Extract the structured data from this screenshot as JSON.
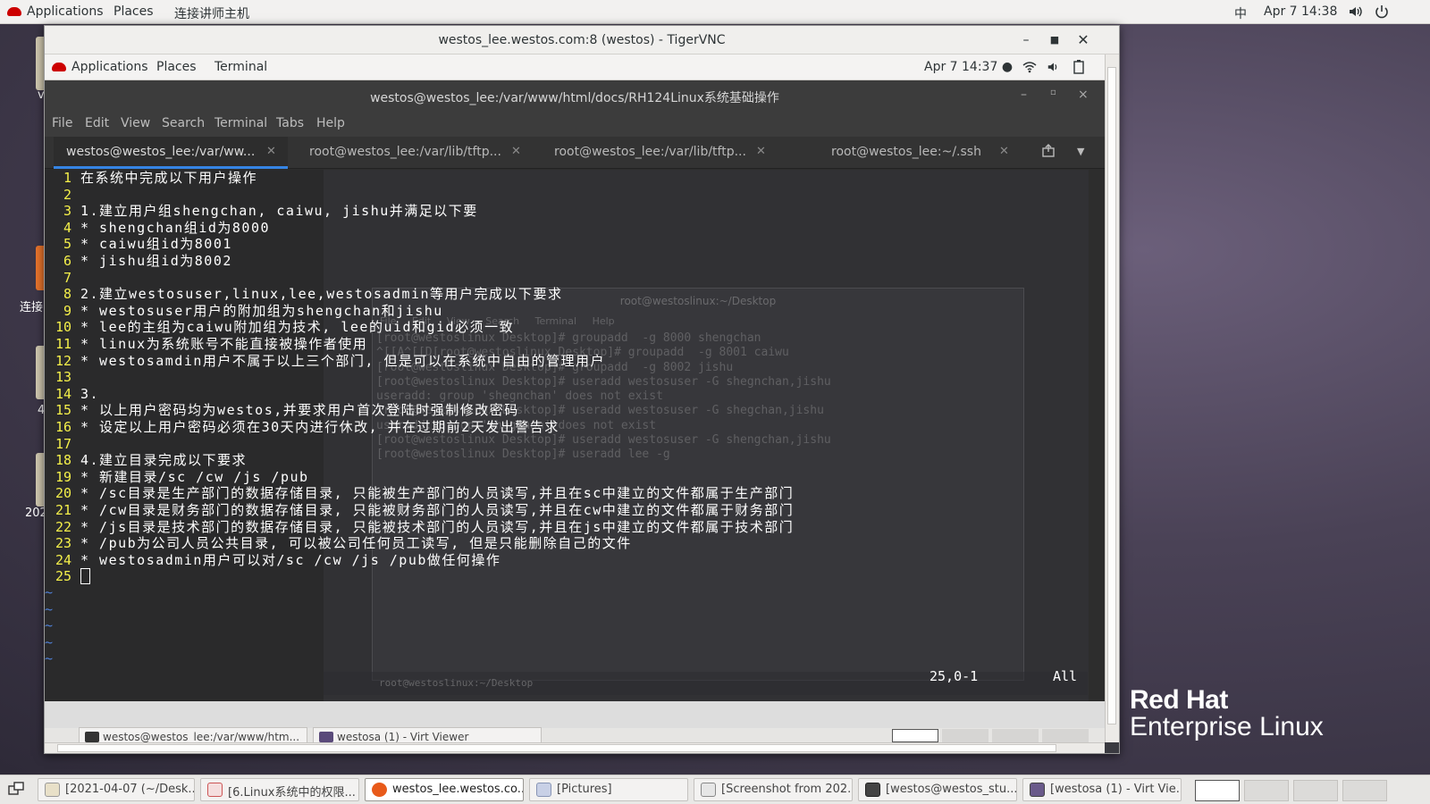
{
  "host": {
    "topbar": {
      "applications": "Applications",
      "places": "Places",
      "connect": "连接讲师主机",
      "input_method": "中",
      "datetime": "Apr 7  14:38"
    },
    "desktop": {
      "partial_label_1": "连接",
      "partial_label_2": "4",
      "partial_label_3": "202",
      "partial_label_4": "v"
    },
    "logo": {
      "line1": "Red Hat",
      "line2": "Enterprise Linux"
    },
    "taskbar": [
      "[2021-04-07 (~/Desk...",
      "[6.Linux系统中的权限...",
      "westos_lee.westos.co...",
      "[Pictures]",
      "[Screenshot from 202...",
      "[westos@westos_stu...",
      "[westosa (1) - Virt Vie..."
    ]
  },
  "vnc": {
    "title": "westos_lee.westos.com:8 (westos) - TigerVNC",
    "vm_topbar": {
      "applications": "Applications",
      "places": "Places",
      "terminal": "Terminal",
      "datetime": "Apr 7  14:37 ●"
    },
    "terminal": {
      "title": "westos@westos_lee:/var/www/html/docs/RH124Linux系统基础操作",
      "menu": [
        "File",
        "Edit",
        "View",
        "Search",
        "Terminal",
        "Tabs",
        "Help"
      ],
      "tabs": [
        "westos@westos_lee:/var/ww...",
        "root@westos_lee:/var/lib/tftp...",
        "root@westos_lee:/var/lib/tftp...",
        "root@westos_lee:~/.ssh"
      ],
      "lines": [
        {
          "n": "1",
          "t": "在系统中完成以下用户操作"
        },
        {
          "n": "2",
          "t": ""
        },
        {
          "n": "3",
          "t": "1.建立用户组shengchan, caiwu, jishu并满足以下要"
        },
        {
          "n": "4",
          "t": "* shengchan组id为8000"
        },
        {
          "n": "5",
          "t": "* caiwu组id为8001"
        },
        {
          "n": "6",
          "t": "* jishu组id为8002"
        },
        {
          "n": "7",
          "t": ""
        },
        {
          "n": "8",
          "t": "2.建立westosuser,linux,lee,westosadmin等用户完成以下要求"
        },
        {
          "n": "9",
          "t": "* westosuser用户的附加组为shengchan和jishu"
        },
        {
          "n": "10",
          "t": "* lee的主组为caiwu附加组为技术, lee的uid和gid必须一致"
        },
        {
          "n": "11",
          "t": "* linux为系统账号不能直接被操作者使用"
        },
        {
          "n": "12",
          "t": "* westosamdin用户不属于以上三个部门, 但是可以在系统中自由的管理用户"
        },
        {
          "n": "13",
          "t": ""
        },
        {
          "n": "14",
          "t": "3."
        },
        {
          "n": "15",
          "t": "* 以上用户密码均为westos,并要求用户首次登陆时强制修改密码"
        },
        {
          "n": "16",
          "t": "* 设定以上用户密码必须在30天内进行休改, 并在过期前2天发出警告求"
        },
        {
          "n": "17",
          "t": ""
        },
        {
          "n": "18",
          "t": "4.建立目录完成以下要求"
        },
        {
          "n": "19",
          "t": "* 新建目录/sc /cw /js /pub"
        },
        {
          "n": "20",
          "t": "* /sc目录是生产部门的数据存储目录, 只能被生产部门的人员读写,并且在sc中建立的文件都属于生产部门"
        },
        {
          "n": "21",
          "t": "* /cw目录是财务部门的数据存储目录, 只能被财务部门的人员读写,并且在cw中建立的文件都属于财务部门"
        },
        {
          "n": "22",
          "t": "* /js目录是技术部门的数据存储目录, 只能被技术部门的人员读写,并且在js中建立的文件都属于技术部门"
        },
        {
          "n": "23",
          "t": "* /pub为公司人员公共目录, 可以被公司任何员工读写, 但是只能删除自己的文件"
        },
        {
          "n": "24",
          "t": "* westosadmin用户可以对/sc /cw /js /pub做任何操作"
        },
        {
          "n": "25",
          "t": ""
        }
      ],
      "tilde": "~",
      "status_pos": "25,0-1",
      "status_all": "All"
    },
    "ghost": {
      "title": "root@westoslinux:~/Desktop",
      "menu": "File Edit View Search Terminal Help",
      "lines": "[root@westoslinux Desktop]# groupadd  -g 8000 shengchan\n^[[A^[[D[root@westoslinux Desktop]# groupadd  -g 8001 caiwu\n[root@westoslinux Desktop]# groupadd  -g 8002 jishu\n[root@westoslinux Desktop]# useradd westosuser -G shegnchan,jishu\nuseradd: group 'shegnchan' does not exist\n[root@westoslinux Desktop]# useradd westosuser -G shegchan,jishu\nuseradd: group 'shegchan' does not exist\n[root@westoslinux Desktop]# useradd westosuser -G shengchan,jishu\n[root@westoslinux Desktop]# useradd lee -g ",
      "taskbar_label": "root@westoslinux:~/Desktop"
    },
    "vm_taskbar": [
      "westos@westos_lee:/var/www/htm...",
      "westosa (1) - Virt Viewer"
    ]
  }
}
